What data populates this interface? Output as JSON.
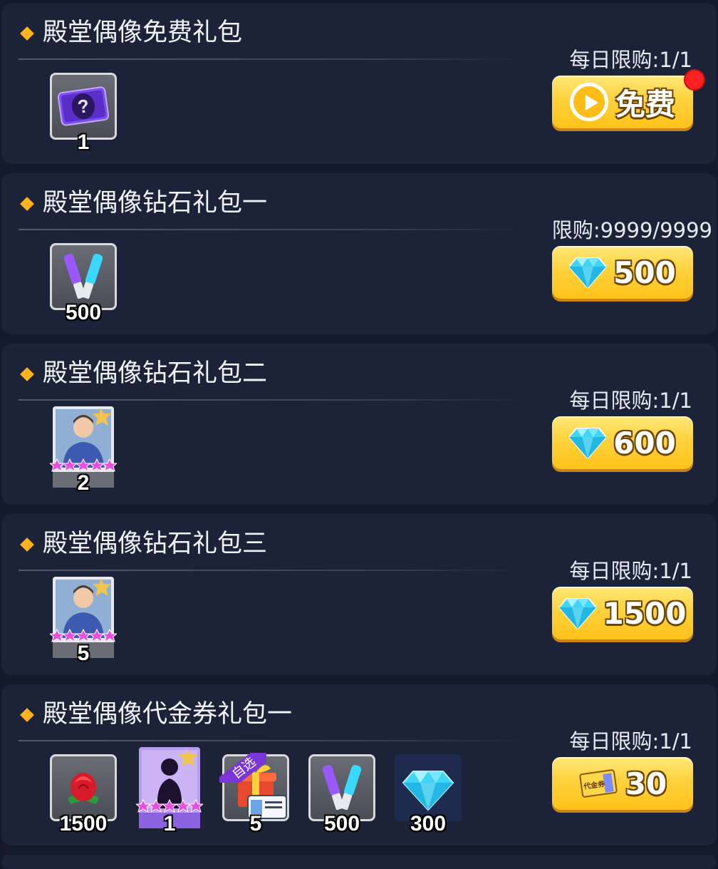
{
  "packs": [
    {
      "title": "殿堂偶像免费礼包",
      "limit": "每日限购:1/1",
      "button": {
        "type": "free",
        "icon": "play-icon",
        "label": "免费"
      },
      "has_red_dot": true,
      "items": [
        {
          "icon": "mystery-card-icon",
          "qty": "1"
        }
      ]
    },
    {
      "title": "殿堂偶像钻石礼包一",
      "limit": "限购:9999/9999",
      "button": {
        "type": "diamond",
        "icon": "diamond-icon",
        "label": "500"
      },
      "items": [
        {
          "icon": "glow-stick-icon",
          "qty": "500"
        }
      ]
    },
    {
      "title": "殿堂偶像钻石礼包二",
      "limit": "每日限购:1/1",
      "button": {
        "type": "diamond",
        "icon": "diamond-icon",
        "label": "600"
      },
      "items": [
        {
          "icon": "idol-card-icon",
          "qty": "2",
          "stars": 5
        }
      ]
    },
    {
      "title": "殿堂偶像钻石礼包三",
      "limit": "每日限购:1/1",
      "button": {
        "type": "diamond",
        "icon": "diamond-icon",
        "label": "1500"
      },
      "items": [
        {
          "icon": "idol-card-icon",
          "qty": "5",
          "stars": 5
        }
      ]
    },
    {
      "title": "殿堂偶像代金券礼包一",
      "limit": "每日限购:1/1",
      "button": {
        "type": "coupon",
        "icon": "voucher-icon",
        "label": "30",
        "icon_text": "代金券"
      },
      "items": [
        {
          "icon": "rose-icon",
          "qty": "1500"
        },
        {
          "icon": "silhouette-idol-card-icon",
          "qty": "1",
          "stars": 5
        },
        {
          "icon": "gift-box-icon",
          "qty": "5",
          "tag": "自选"
        },
        {
          "icon": "glow-stick-icon",
          "qty": "500"
        },
        {
          "icon": "diamond-icon",
          "qty": "300"
        }
      ]
    }
  ],
  "colors": {
    "background": "#141a2c",
    "panel": "#1c2338",
    "accent_bullet": "#ffb21c",
    "button_gold": "#ffd23c",
    "red_dot": "#ff2020",
    "diamond": "#3fd6f5"
  }
}
